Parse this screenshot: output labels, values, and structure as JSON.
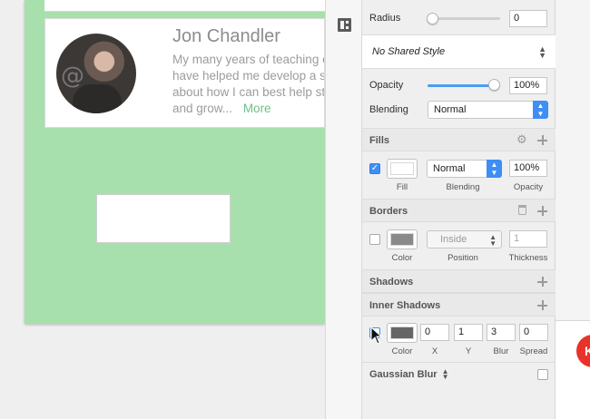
{
  "canvas": {
    "profile": {
      "name": "Jon Chandler",
      "bio_lines": [
        "My many years of teaching exp",
        "have helped me develop a set o",
        "about how I can best help stude",
        "and grow..."
      ],
      "more_link": "More"
    }
  },
  "inspector": {
    "radius": {
      "label": "Radius",
      "value": "0"
    },
    "shared_style": {
      "label": "No Shared Style"
    },
    "opacity": {
      "label": "Opacity",
      "value": "100%",
      "level": 1.0
    },
    "blending": {
      "label": "Blending",
      "value": "Normal"
    },
    "fills": {
      "title": "Fills",
      "enabled": true,
      "blend": "Normal",
      "opacity": "100%",
      "labels": {
        "fill": "Fill",
        "blending": "Blending",
        "opacity": "Opacity"
      },
      "color": "#ffffff"
    },
    "borders": {
      "title": "Borders",
      "enabled": false,
      "position": "Inside",
      "thickness": "1",
      "labels": {
        "color": "Color",
        "position": "Position",
        "thickness": "Thickness"
      },
      "color": "#8a8a8a"
    },
    "shadows": {
      "title": "Shadows"
    },
    "inner_shadows": {
      "title": "Inner Shadows",
      "x": "0",
      "y": "1",
      "blur": "3",
      "spread": "0",
      "labels": {
        "color": "Color",
        "x": "X",
        "y": "Y",
        "blur": "Blur",
        "spread": "Spread"
      },
      "color": "#555555"
    },
    "gaussian_blur": {
      "title": "Gaussian Blur"
    }
  },
  "badge": {
    "text": "K"
  },
  "colors": {
    "artboard": "#a8e0ad",
    "accent": "#3d8ef5",
    "badge": "#e8322a",
    "link": "#6fbf87"
  }
}
